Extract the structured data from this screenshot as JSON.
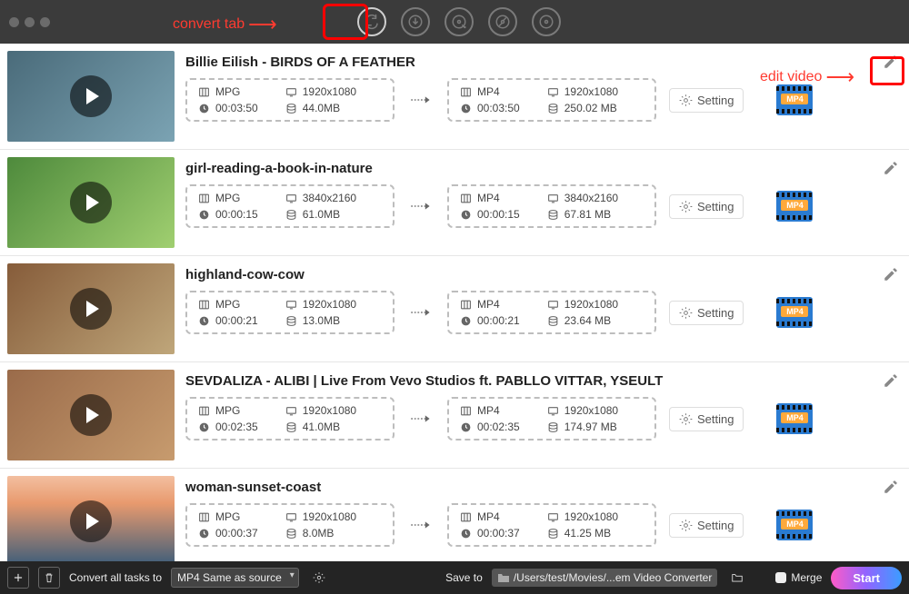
{
  "annotations": {
    "convert_tab": "convert tab",
    "edit_video": "edit video"
  },
  "videos": [
    {
      "title": "Billie Eilish - BIRDS OF A FEATHER",
      "thumb_class": "thumb1",
      "src": {
        "format": "MPG",
        "duration": "00:03:50",
        "res": "1920x1080",
        "size": "44.0MB"
      },
      "dst": {
        "format": "MP4",
        "duration": "00:03:50",
        "res": "1920x1080",
        "size": "250.02 MB"
      }
    },
    {
      "title": "girl-reading-a-book-in-nature",
      "thumb_class": "thumb2",
      "src": {
        "format": "MPG",
        "duration": "00:00:15",
        "res": "3840x2160",
        "size": "61.0MB"
      },
      "dst": {
        "format": "MP4",
        "duration": "00:00:15",
        "res": "3840x2160",
        "size": "67.81 MB"
      }
    },
    {
      "title": "highland-cow-cow",
      "thumb_class": "thumb3",
      "src": {
        "format": "MPG",
        "duration": "00:00:21",
        "res": "1920x1080",
        "size": "13.0MB"
      },
      "dst": {
        "format": "MP4",
        "duration": "00:00:21",
        "res": "1920x1080",
        "size": "23.64 MB"
      }
    },
    {
      "title": "SEVDALIZA - ALIBI | Live From Vevo Studios ft. PABLLO VITTAR, YSEULT",
      "thumb_class": "thumb4",
      "src": {
        "format": "MPG",
        "duration": "00:02:35",
        "res": "1920x1080",
        "size": "41.0MB"
      },
      "dst": {
        "format": "MP4",
        "duration": "00:02:35",
        "res": "1920x1080",
        "size": "174.97 MB"
      }
    },
    {
      "title": "woman-sunset-coast",
      "thumb_class": "thumb5",
      "src": {
        "format": "MPG",
        "duration": "00:00:37",
        "res": "1920x1080",
        "size": "8.0MB"
      },
      "dst": {
        "format": "MP4",
        "duration": "00:00:37",
        "res": "1920x1080",
        "size": "41.25 MB"
      }
    }
  ],
  "setting_label": "Setting",
  "format_badge": "MP4",
  "bottom": {
    "convert_label": "Convert all tasks to",
    "convert_value": "MP4 Same as source",
    "save_label": "Save to",
    "save_path": "/Users/test/Movies/...em Video Converter",
    "merge_label": "Merge",
    "start_label": "Start"
  }
}
